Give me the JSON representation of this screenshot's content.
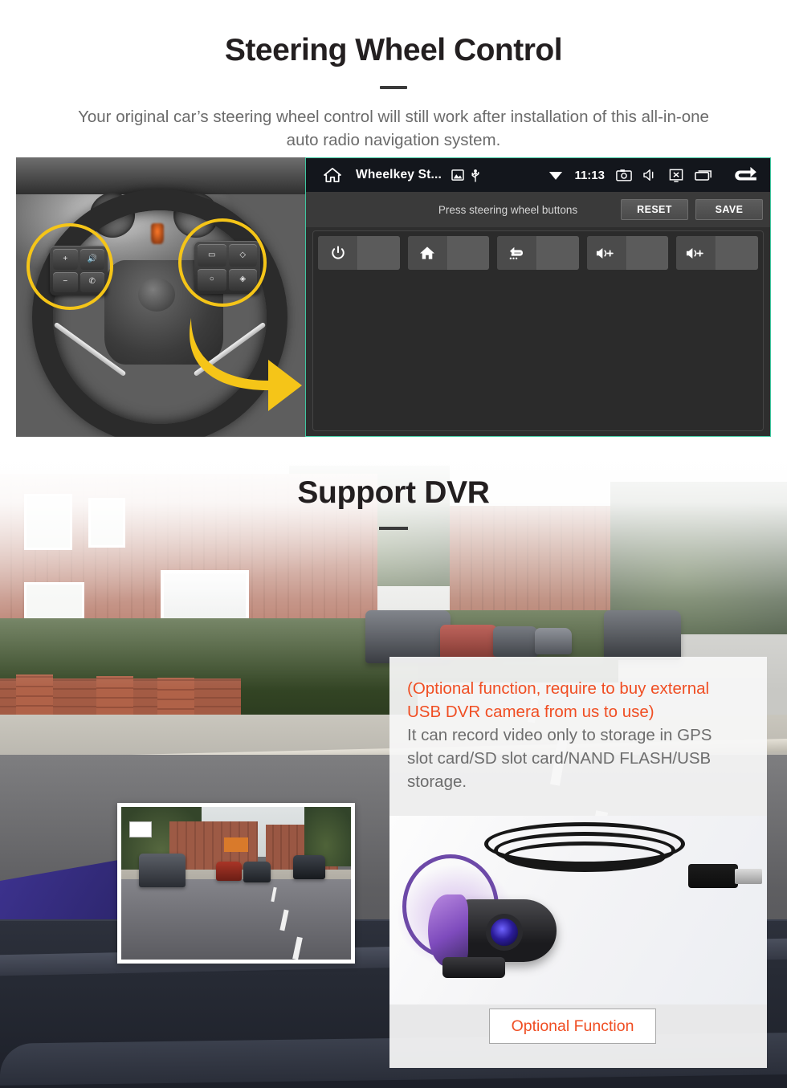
{
  "steering_section": {
    "title": "Steering Wheel Control",
    "subtitle": "Your original car’s steering wheel control will still work after installation of this all-in-one auto radio navigation system.",
    "photo_alt": "steering-wheel-with-highlighted-control-buttons",
    "wheel_left_pad_keys": [
      "+",
      "−",
      "🔊",
      "✆"
    ],
    "wheel_right_pad_keys": [
      "▭",
      "◇",
      "○",
      "◈"
    ],
    "android": {
      "status_bar": {
        "home_icon": "home-icon",
        "app_title": "Wheelkey St...",
        "image_icon": "image-icon",
        "usb_icon": "usb-icon",
        "wifi_icon": "wifi-icon",
        "clock": "11:13",
        "screenshot_icon": "screenshot-camera-icon",
        "mute_icon": "volume-mute-icon",
        "screen_off_icon": "screen-off-icon",
        "recents_icon": "recent-apps-icon",
        "back_icon": "back-arrow-icon"
      },
      "toolbar": {
        "hint": "Press steering wheel buttons",
        "reset_label": "RESET",
        "save_label": "SAVE"
      },
      "keys": [
        {
          "icon": "power-icon",
          "glyph": "⏻",
          "value": ""
        },
        {
          "icon": "home-icon",
          "glyph": "⌂",
          "value": ""
        },
        {
          "icon": "back-icon",
          "glyph": "↩",
          "value": ""
        },
        {
          "icon": "volume-up-icon",
          "glyph": "🔊+",
          "value": ""
        },
        {
          "icon": "volume-up-icon",
          "glyph": "🔊+",
          "value": ""
        }
      ]
    }
  },
  "dvr_section": {
    "title": "Support DVR",
    "background_alt": "dashcam-street-view-of-residential-road",
    "preview_alt": "dvr-recorded-video-preview",
    "camera_alt": "usb-dvr-camera-with-coiled-cable",
    "card": {
      "orange_lines": [
        "(Optional function, require to buy external",
        "USB DVR camera from us to use)"
      ],
      "grey_lines": [
        "It can record video only to storage in GPS",
        "slot card/SD slot card/NAND FLASH/USB",
        "storage."
      ],
      "button_label": "Optional Function"
    }
  },
  "colors": {
    "accent_orange": "#f04e23",
    "highlight_yellow": "#f5c518",
    "panel_border_teal": "#3ec7a0",
    "heading_dark": "#231f20",
    "body_grey": "#6b6b6b"
  }
}
